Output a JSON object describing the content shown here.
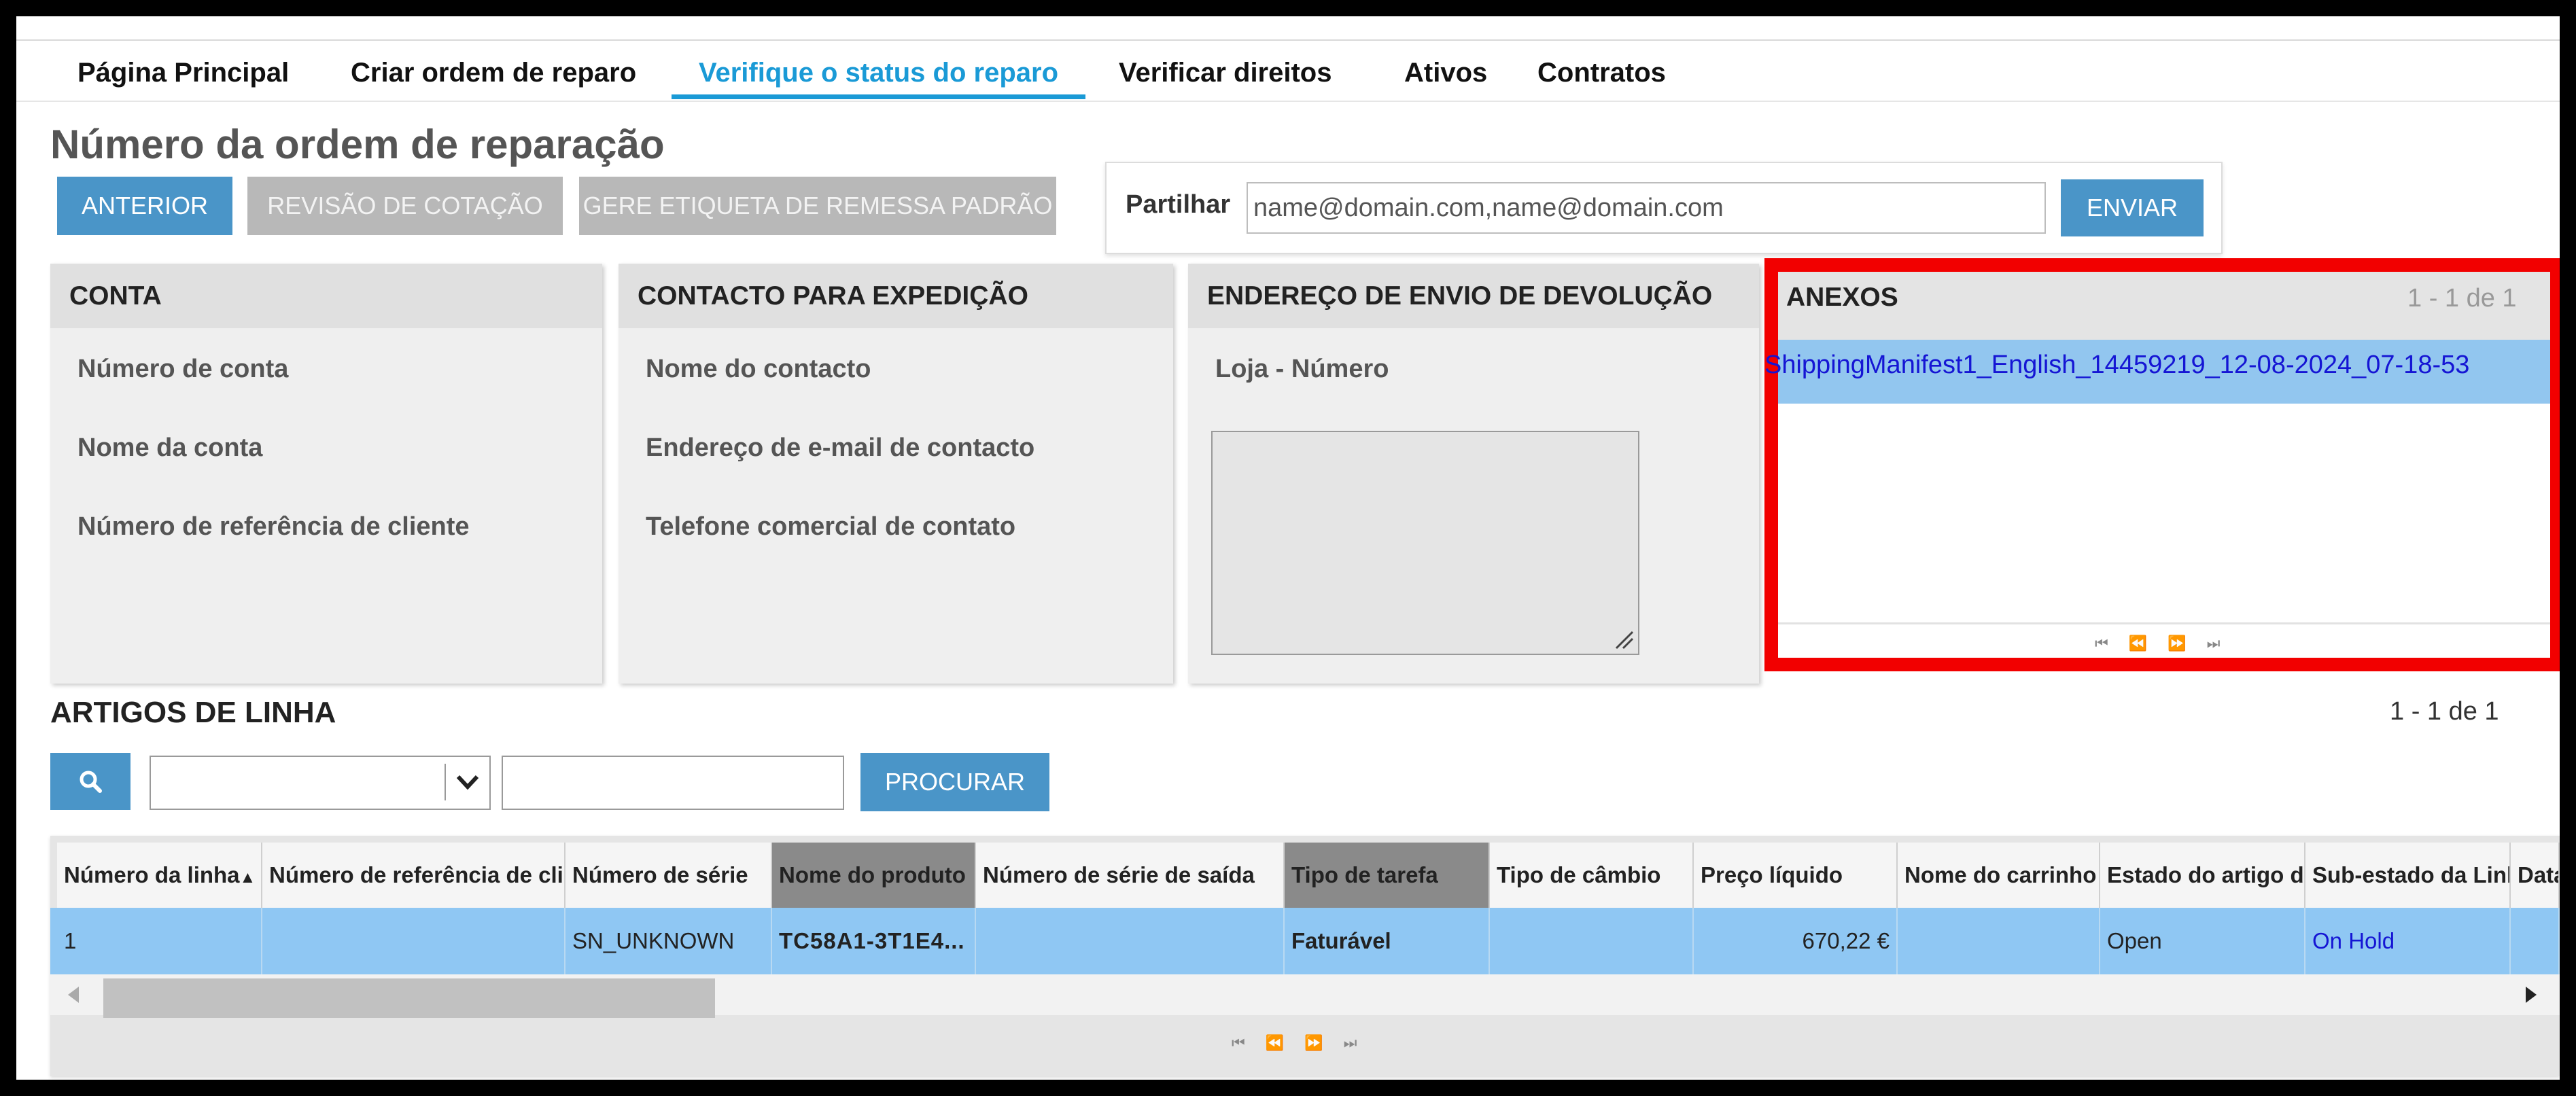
{
  "nav": {
    "items": [
      {
        "label": "Página Principal"
      },
      {
        "label": "Criar ordem de reparo"
      },
      {
        "label": "Verifique o status do reparo"
      },
      {
        "label": "Verificar direitos"
      },
      {
        "label": "Ativos"
      },
      {
        "label": "Contratos"
      }
    ]
  },
  "page": {
    "title": "Número da ordem de reparação"
  },
  "toolbar": {
    "prev_label": "ANTERIOR",
    "quote_review_label": "REVISÃO DE COTAÇÃO",
    "label_gen_label": "GERE ETIQUETA DE REMESSA PADRÃO"
  },
  "share": {
    "label": "Partilhar",
    "placeholder": "name@domain.com,name@domain.com",
    "send_label": "ENVIAR"
  },
  "panels": {
    "account": {
      "title": "CONTA",
      "fields": [
        "Número de conta",
        "Nome da conta",
        "Número de referência de cliente"
      ]
    },
    "contact": {
      "title": "CONTACTO PARA EXPEDIÇÃO",
      "fields": [
        "Nome do contacto",
        "Endereço de e-mail de contacto",
        "Telefone comercial de contato"
      ]
    },
    "return_address": {
      "title": "ENDEREÇO DE ENVIO DE DEVOLUÇÃO",
      "fields": [
        "Loja - Número"
      ]
    },
    "attachments": {
      "title": "ANEXOS",
      "count": "1 - 1 de 1",
      "items": [
        "ShippingManifest1_English_14459219_12-08-2024_07-18-53"
      ]
    }
  },
  "line_items": {
    "title": "ARTIGOS DE LINHA",
    "count": "1 - 1 de 1",
    "search_label": "PROCURAR",
    "columns": [
      "Número da linha",
      "Número de referência de cliente",
      "Número de série",
      "Nome do produto",
      "Número de série de saída",
      "Tipo de tarefa",
      "Tipo de câmbio",
      "Preço líquido",
      "Nome do carrinho de compras",
      "Estado do artigo de linha",
      "Sub-estado da Linha",
      "Data"
    ],
    "rows": [
      [
        "1",
        "",
        "SN_UNKNOWN",
        "TC58A1-3T1E4...",
        "",
        "Faturável",
        "",
        "670,22 €",
        "",
        "Open",
        "On Hold",
        ""
      ]
    ]
  },
  "icons": [
    "search-icon",
    "chevron-down-icon",
    "sort-asc-icon",
    "resize-grip-icon",
    "first-page-icon",
    "prev-page-icon",
    "next-page-icon",
    "last-page-icon",
    "scroll-left-icon",
    "scroll-right-icon"
  ],
  "colors": {
    "accent": "#1a9ad6",
    "button": "#4a95c8",
    "highlight_row": "#8fc7f3",
    "annotation": "#f20000",
    "link": "#1515d4"
  }
}
